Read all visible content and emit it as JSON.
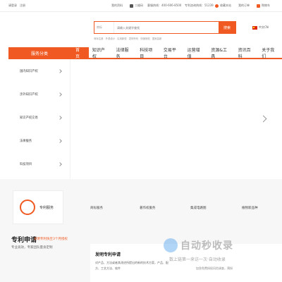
{
  "topbar": {
    "login": "请登录",
    "register": "注册",
    "my_info": "我的资料",
    "qrcode": "二维码",
    "hotline": "客服热线：400-606-8500",
    "consult": "专利咨询热线：51239",
    "favorites": "收藏本站",
    "my_orders": "我的订单",
    "cart": "购物车"
  },
  "search": {
    "category": "商标",
    "placeholder": "请输入关键字查找",
    "button": "搜索",
    "hot_links": [
      "商标注册",
      "外观设计",
      "实用新型",
      "发明专利",
      "快速授权",
      "国家高新"
    ]
  },
  "lang": {
    "label": "中文CN"
  },
  "nav": {
    "category_header": "服务分类",
    "items": [
      "首页",
      "知识产权",
      "法律服务",
      "科技项目",
      "交易平台",
      "运营增值",
      "资源&工具",
      "资讯百科",
      "关于我们"
    ]
  },
  "sidebar": {
    "items": [
      "国内知识产权",
      "涉外知识产权",
      "知识产权交易",
      "法律服务",
      "科技项目"
    ]
  },
  "services": {
    "card_label": "专利服务",
    "tabs": [
      "商标服务",
      "著作权服务",
      "集成电路图",
      "植物新品种"
    ]
  },
  "main": {
    "title": "专利申请",
    "subtitle": "发明专利快至3个月授权",
    "desc": "专业高效，专家团队量身定制"
  },
  "panel": {
    "title": "发明专利申请",
    "desc": "对产品、方法或者其改进所提出的新的技术方案，产品、配方、工艺方法、软件",
    "note": "加急免费授权风险调查，预授"
  },
  "watermark": {
    "text": "自动秒收录",
    "sub": "数上链第一来访一次·自动收录"
  }
}
